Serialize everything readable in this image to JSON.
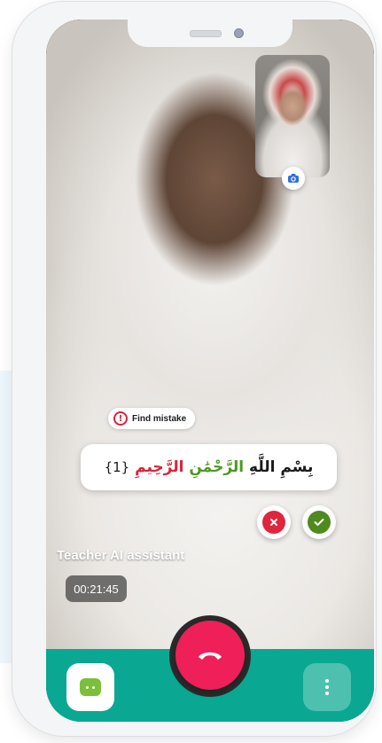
{
  "call": {
    "teacher_name": "Teacher AI assistant",
    "timer": "00:21:45"
  },
  "mistake": {
    "label": "Find mistake",
    "icon": "exclamation-icon"
  },
  "verse": {
    "part_black": "بِسْمِ اللَّهِ",
    "part_green": "الرَّحْمَٰنِ",
    "part_red": "الرَّحِيمِ",
    "number": "{1}"
  },
  "colors": {
    "accent_teal": "#0aa892",
    "end_call_red": "#ef1f59",
    "reject_red": "#e0263c",
    "accept_green": "#4f8a1e",
    "verse_green": "#4a9a1f",
    "verse_red": "#d9233a",
    "chat_green": "#7bbf3a"
  },
  "icons": {
    "camera_switch": "camera-switch-icon",
    "reject": "x-icon",
    "accept": "check-icon",
    "end_call": "phone-hangup-icon",
    "chat": "chat-icon",
    "more": "more-vertical-icon"
  }
}
